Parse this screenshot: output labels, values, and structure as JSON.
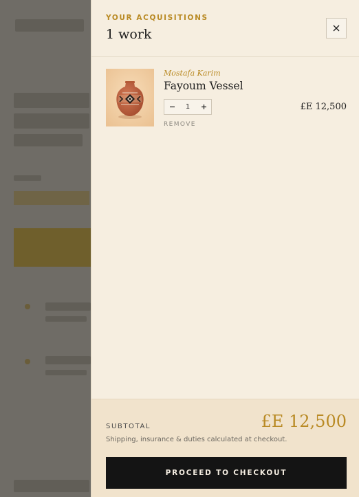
{
  "drawer": {
    "eyebrow": "YOUR ACQUISITIONS",
    "count": "1 work",
    "close_icon": "close-icon"
  },
  "items": [
    {
      "artist": "Mostafa Karim",
      "title": "Fayoum Vessel",
      "quantity": "1",
      "decrement_icon": "minus-icon",
      "increment_icon": "plus-icon",
      "remove_label": "REMOVE",
      "price": "£E 12,500",
      "thumbnail": "vase-thumbnail"
    }
  ],
  "footer": {
    "subtotal_label": "SUBTOTAL",
    "subtotal_value": "£E 12,500",
    "shipping_note": "Shipping, insurance & duties calculated at checkout.",
    "checkout_label": "PROCEED TO CHECKOUT"
  },
  "colors": {
    "accent_gold": "#b98a24",
    "drawer_bg": "#f6eee0",
    "footer_bg": "#f1e3cc",
    "checkout_bg": "#141414",
    "overlay": "#6f6c66"
  }
}
